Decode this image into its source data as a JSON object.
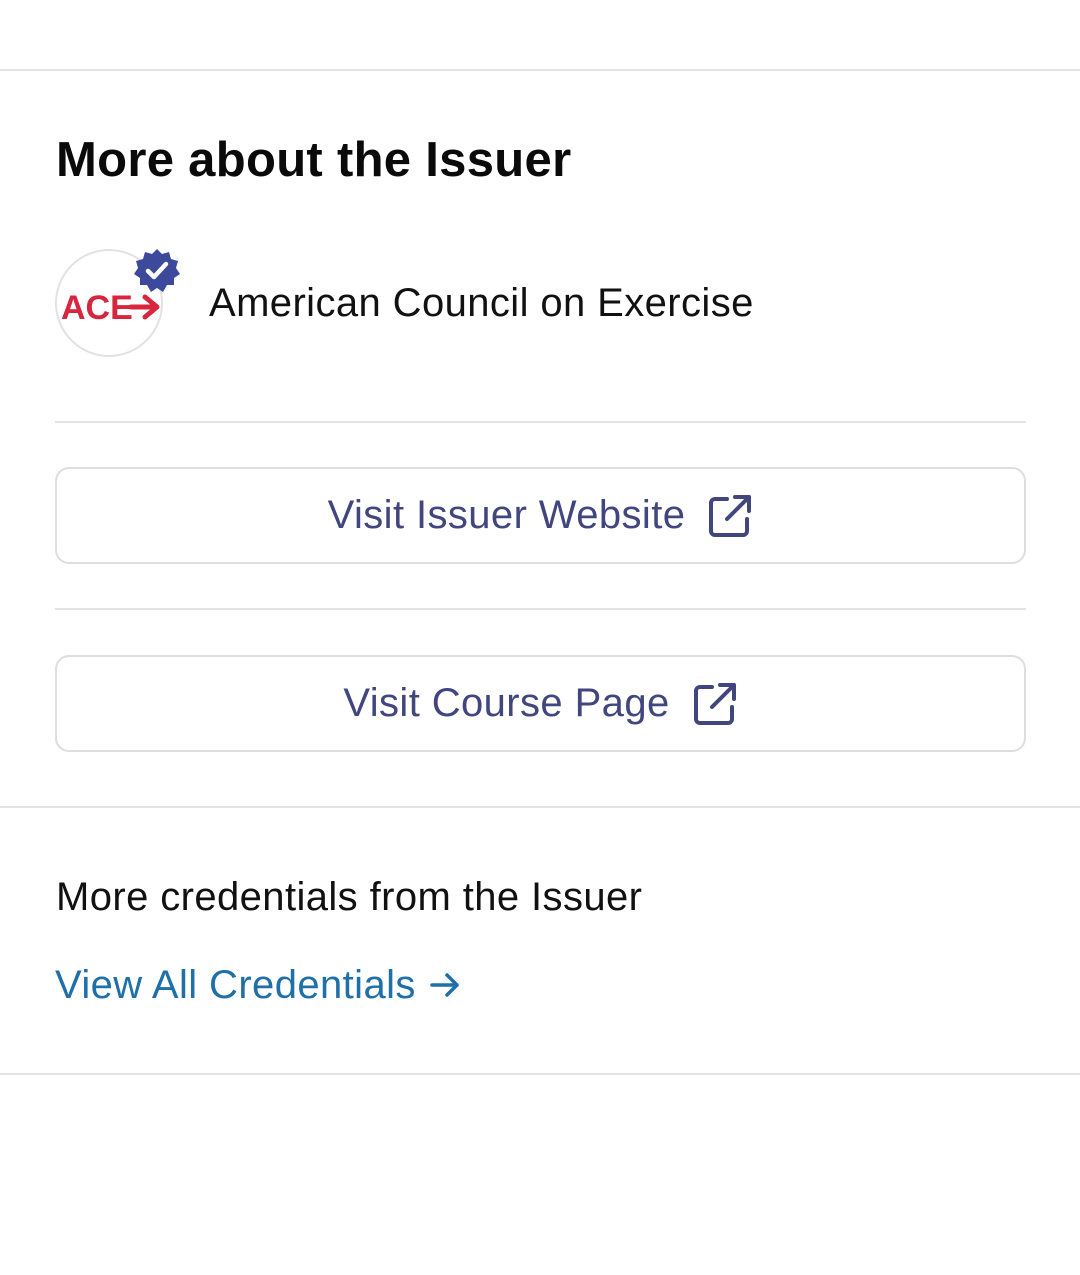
{
  "section": {
    "title": "More about the Issuer"
  },
  "issuer": {
    "name": "American Council on Exercise",
    "logo_text": "ACE",
    "brand_color": "#d7263d",
    "verified_badge_color": "#3d4a9c"
  },
  "buttons": {
    "website_label": "Visit Issuer Website",
    "course_label": "Visit Course Page",
    "icon": "external-link-icon"
  },
  "credentials": {
    "label": "More credentials from the Issuer",
    "view_all_label": "View All Credentials",
    "link_color": "#1f6fa8"
  },
  "colors": {
    "button_text": "#41467e",
    "divider": "#e3e3e3"
  }
}
